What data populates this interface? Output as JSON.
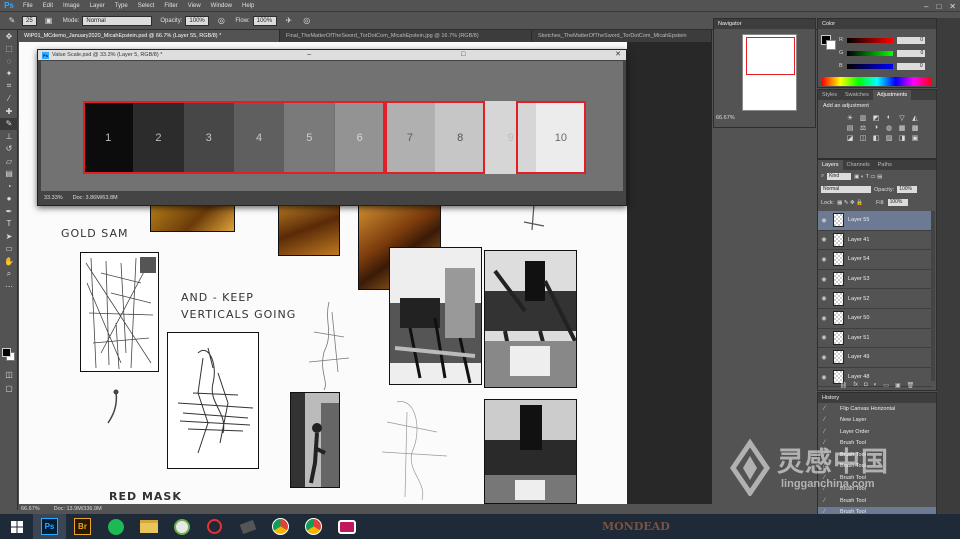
{
  "app": {
    "menu": [
      "File",
      "Edit",
      "Image",
      "Layer",
      "Type",
      "Select",
      "Filter",
      "View",
      "Window",
      "Help"
    ],
    "logo": "Ps",
    "window_controls": [
      "–",
      "□",
      "✕"
    ]
  },
  "options": {
    "brush_size": "25",
    "mode_label": "Mode:",
    "mode_value": "Normal",
    "opacity_label": "Opacity:",
    "opacity_value": "100%",
    "flow_label": "Flow:",
    "flow_value": "100%"
  },
  "tabs": [
    {
      "label": "WIP01_MCdemo_January2020_MicahEpstein.psd @ 66.7% (Layer 55, RGB/8) *",
      "active": true
    },
    {
      "label": "Final_TheMatterOfTheSword_TorDotCom_MicahEpstein.jpg @ 16.7% (RGB/8)",
      "active": false
    },
    {
      "label": "Sketches_TheMatterOfTheSword_TorDotCom_MicahEpstein",
      "active": false
    }
  ],
  "canvas": {
    "labels": [
      "GOLD SAM",
      "AND - KEEP",
      "VERTICALS GOING",
      "RED MASK"
    ]
  },
  "value_window": {
    "title": "Value Scale.psd @ 33.3% (Layer 5, RGB/8) *",
    "zoom": "33.33%",
    "doc": "Doc: 3.86M/63.8M",
    "steps": [
      {
        "label": "1",
        "color": "#0c0c0c",
        "text_color": "#bdbdbd"
      },
      {
        "label": "2",
        "color": "#2c2c2c",
        "text_color": "#bdbdbd"
      },
      {
        "label": "3",
        "color": "#474747",
        "text_color": "#c5c5c5"
      },
      {
        "label": "4",
        "color": "#5f5f5f",
        "text_color": "#c9c9c9"
      },
      {
        "label": "5",
        "color": "#7a7a7a",
        "text_color": "#d0d0d0"
      },
      {
        "label": "6",
        "color": "#939393",
        "text_color": "#d8d8d8"
      },
      {
        "label": "7",
        "color": "#b0b0b0",
        "text_color": "#5a5a5a"
      },
      {
        "label": "8",
        "color": "#c6c6c6",
        "text_color": "#555555"
      },
      {
        "label": "9",
        "color": "#d6d6d6",
        "text_color": "#bdbdbd"
      },
      {
        "label": "10",
        "color": "#ececec",
        "text_color": "#6a6a6a"
      }
    ]
  },
  "status": {
    "zoom": "66.67%",
    "doc": "Doc: 13.9M/336.9M"
  },
  "navigator": {
    "title": "Navigator",
    "zoom": "66.67%"
  },
  "color_panel": {
    "title": "Color",
    "channels": [
      {
        "label": "R",
        "value": "0"
      },
      {
        "label": "G",
        "value": "0"
      },
      {
        "label": "B",
        "value": "0"
      }
    ]
  },
  "adjustments": {
    "tabs": [
      "Styles",
      "Swatches",
      "Adjustments"
    ],
    "heading": "Add an adjustment",
    "icons": [
      "☀",
      "▥",
      "◩",
      "◐",
      "▽",
      "◭",
      "▤",
      "⚖",
      "◑",
      "◍",
      "▦",
      "▩",
      "◪",
      "◫",
      "◧",
      "▨",
      "◨",
      "▣"
    ]
  },
  "layers": {
    "tabs": [
      "Layers",
      "Channels",
      "Paths"
    ],
    "kind": "Kind",
    "blend": "Normal",
    "opacity_label": "Opacity:",
    "opacity": "100%",
    "lock_label": "Lock:",
    "fill_label": "Fill:",
    "fill": "100%",
    "items": [
      {
        "name": "Layer 55",
        "selected": true
      },
      {
        "name": "Layer 41",
        "selected": false
      },
      {
        "name": "Layer 54",
        "selected": false
      },
      {
        "name": "Layer 53",
        "selected": false
      },
      {
        "name": "Layer 52",
        "selected": false
      },
      {
        "name": "Layer 50",
        "selected": false
      },
      {
        "name": "Layer 51",
        "selected": false
      },
      {
        "name": "Layer 49",
        "selected": false
      },
      {
        "name": "Layer 48",
        "selected": false
      }
    ]
  },
  "history": {
    "title": "History",
    "items": [
      {
        "label": "Flip Canvas Horizontal",
        "selected": false
      },
      {
        "label": "New Layer",
        "selected": false
      },
      {
        "label": "Layer Order",
        "selected": false
      },
      {
        "label": "Brush Tool",
        "selected": false
      },
      {
        "label": "Brush Tool",
        "selected": false
      },
      {
        "label": "Brush Tool",
        "selected": false
      },
      {
        "label": "Brush Tool",
        "selected": false
      },
      {
        "label": "Brush Tool",
        "selected": false
      },
      {
        "label": "Brush Tool",
        "selected": false
      },
      {
        "label": "Brush Tool",
        "selected": true
      }
    ]
  },
  "watermark": {
    "main": "灵感中国",
    "url": "lingganchina.com"
  },
  "taskbar": {
    "mondead": "MONDEAD"
  }
}
